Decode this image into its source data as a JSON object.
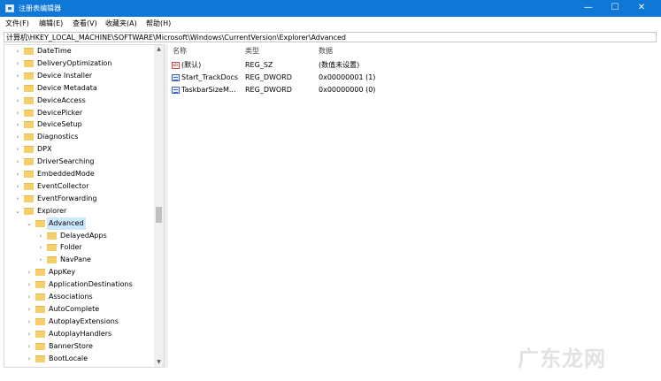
{
  "window": {
    "title": "注册表编辑器",
    "minimize_glyph": "—",
    "maximize_glyph": "☐",
    "close_glyph": "✕",
    "accent": "#0f78d7"
  },
  "menu": [
    "文件(F)",
    "编辑(E)",
    "查看(V)",
    "收藏夹(A)",
    "帮助(H)"
  ],
  "address": "计算机\\HKEY_LOCAL_MACHINE\\SOFTWARE\\Microsoft\\Windows\\CurrentVersion\\Explorer\\Advanced",
  "tree": [
    {
      "label": "DateTime",
      "arrow": "›"
    },
    {
      "label": "DeliveryOptimization",
      "arrow": "›"
    },
    {
      "label": "Device Installer",
      "arrow": "›"
    },
    {
      "label": "Device Metadata",
      "arrow": "›"
    },
    {
      "label": "DeviceAccess",
      "arrow": "›"
    },
    {
      "label": "DevicePicker",
      "arrow": "›"
    },
    {
      "label": "DeviceSetup",
      "arrow": "›"
    },
    {
      "label": "Diagnostics",
      "arrow": "›"
    },
    {
      "label": "DPX",
      "arrow": "›"
    },
    {
      "label": "DriverSearching",
      "arrow": "›"
    },
    {
      "label": "EmbeddedMode",
      "arrow": "›"
    },
    {
      "label": "EventCollector",
      "arrow": "›"
    },
    {
      "label": "EventForwarding",
      "arrow": "›"
    },
    {
      "label": "Explorer",
      "arrow": "⌄"
    },
    {
      "label": "Advanced",
      "arrow": "⌄"
    },
    {
      "label": "DelayedApps",
      "arrow": "›"
    },
    {
      "label": "Folder",
      "arrow": "›"
    },
    {
      "label": "NavPane",
      "arrow": "›"
    },
    {
      "label": "AppKey",
      "arrow": "›"
    },
    {
      "label": "ApplicationDestinations",
      "arrow": "›"
    },
    {
      "label": "Associations",
      "arrow": "›"
    },
    {
      "label": "AutoComplete",
      "arrow": "›"
    },
    {
      "label": "AutoplayExtensions",
      "arrow": "›"
    },
    {
      "label": "AutoplayHandlers",
      "arrow": "›"
    },
    {
      "label": "BannerStore",
      "arrow": "›"
    },
    {
      "label": "BootLocale",
      "arrow": "›"
    }
  ],
  "columns": {
    "name": "名称",
    "type": "类型",
    "data": "数据"
  },
  "values": [
    {
      "name": "(默认)",
      "type": "REG_SZ",
      "data": "(数值未设置)",
      "icon": "string-value-icon"
    },
    {
      "name": "Start_TrackDocs",
      "type": "REG_DWORD",
      "data": "0x00000001 (1)",
      "icon": "dword-value-icon"
    },
    {
      "name": "TaskbarSizeM...",
      "type": "REG_DWORD",
      "data": "0x00000000 (0)",
      "icon": "dword-value-icon"
    }
  ],
  "watermark": "广东龙网"
}
